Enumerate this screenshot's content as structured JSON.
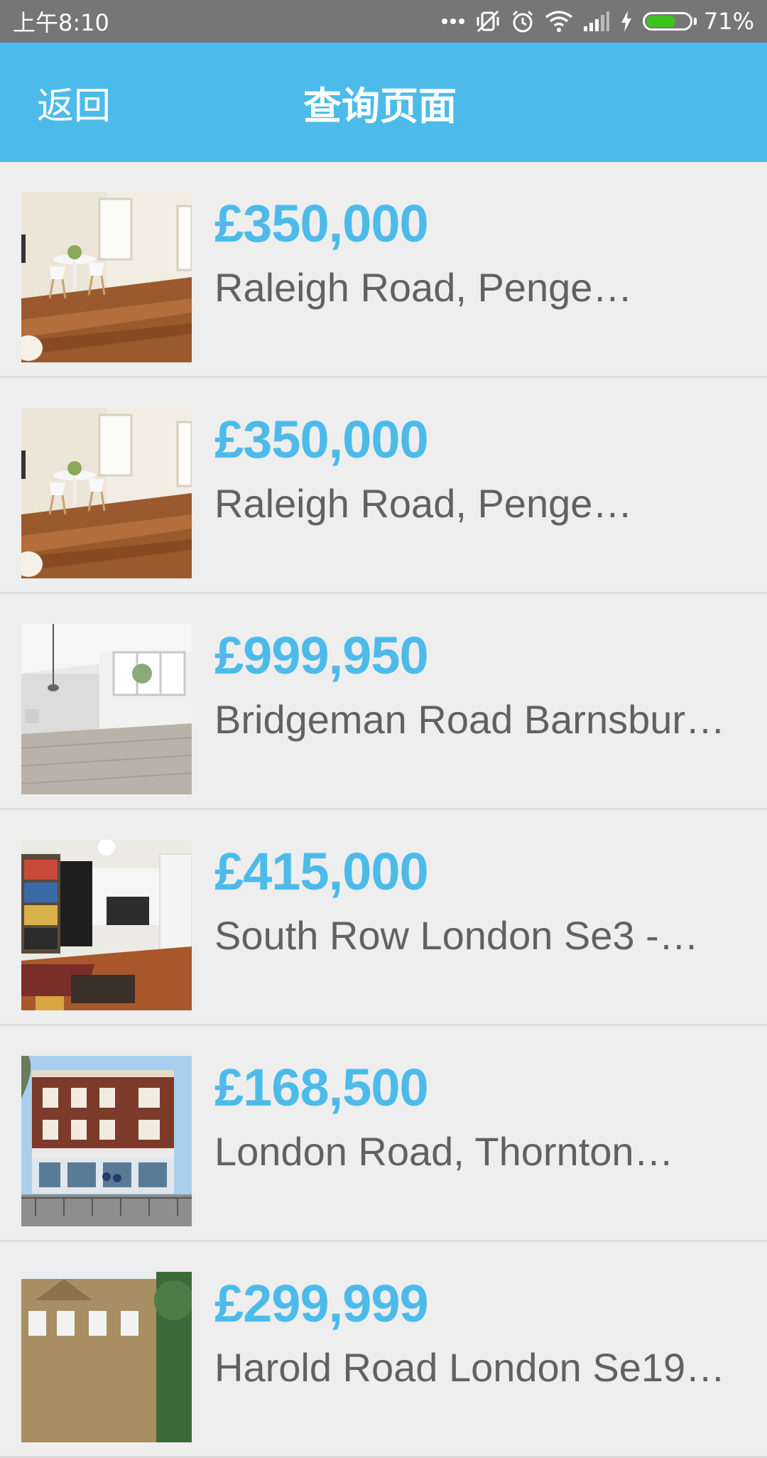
{
  "status_bar": {
    "time": "上午8:10",
    "battery_text": "71%",
    "battery_level": 0.71,
    "icons": [
      "more-dots-icon",
      "vibrate-off-icon",
      "alarm-icon",
      "wifi-icon",
      "signal-icon",
      "charging-icon",
      "battery-icon"
    ]
  },
  "header": {
    "back_label": "返回",
    "title": "查询页面"
  },
  "colors": {
    "accent": "#4cbbea",
    "background": "#eeeeee",
    "status_bar": "#767676",
    "address_text": "#616161",
    "battery_fill": "#3ec21e"
  },
  "listings": [
    {
      "price": "£350,000",
      "address": "Raleigh Road, Penge…",
      "photo": "living-room-photo"
    },
    {
      "price": "£350,000",
      "address": "Raleigh Road, Penge…",
      "photo": "living-room-photo"
    },
    {
      "price": "£999,950",
      "address": "Bridgeman Road Barnsbur…",
      "photo": "empty-room-photo"
    },
    {
      "price": "£415,000",
      "address": "South Row London Se3 -…",
      "photo": "open-plan-room-photo"
    },
    {
      "price": "£168,500",
      "address": "London Road, Thornton…",
      "photo": "brick-building-photo"
    },
    {
      "price": "£299,999",
      "address": "Harold Road London Se19…",
      "photo": "victorian-house-photo"
    }
  ]
}
